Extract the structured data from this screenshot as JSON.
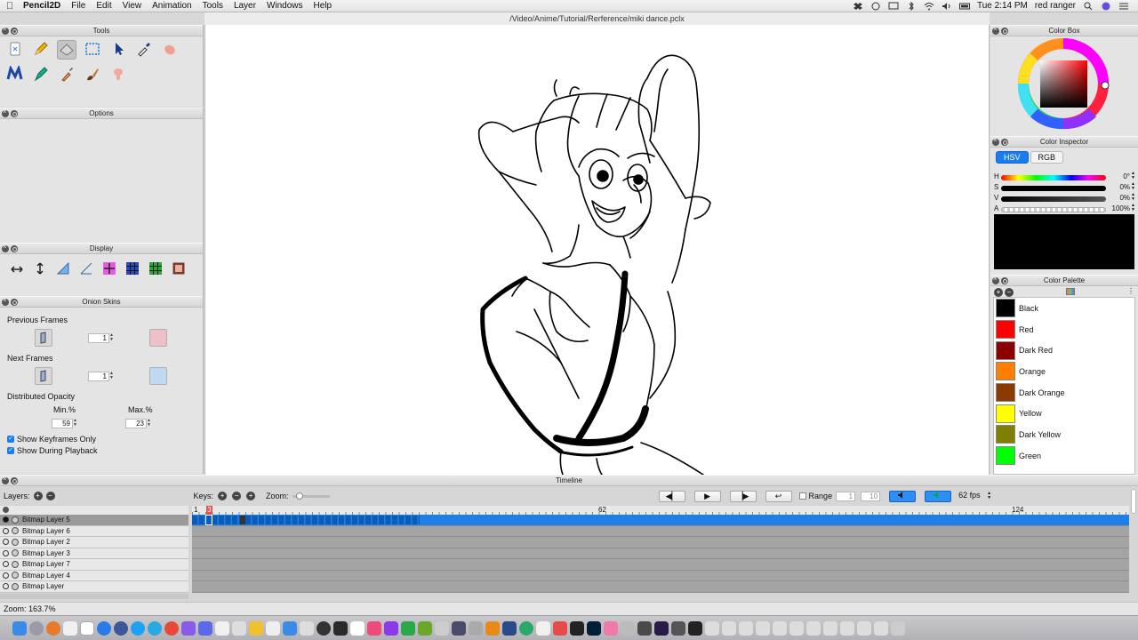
{
  "menubar": {
    "app_name": "Pencil2D",
    "items": [
      "File",
      "Edit",
      "View",
      "Animation",
      "Tools",
      "Layer",
      "Windows",
      "Help"
    ],
    "clock": "Tue 2:14 PM",
    "user": "red ranger"
  },
  "window": {
    "title": "/Video/Anime/Tutorial/Rerference/miki dance.pclx"
  },
  "panels": {
    "tools": "Tools",
    "options": "Options",
    "display": "Display",
    "onion": "Onion Skins",
    "color_box": "Color Box",
    "color_inspector": "Color Inspector",
    "color_palette": "Color Palette",
    "timeline": "Timeline"
  },
  "tools": [
    {
      "name": "clear-icon"
    },
    {
      "name": "pencil-icon"
    },
    {
      "name": "eraser-icon"
    },
    {
      "name": "select-icon"
    },
    {
      "name": "move-icon"
    },
    {
      "name": "eyedropper-icon"
    },
    {
      "name": "hand-icon"
    },
    {
      "name": "polyline-icon"
    },
    {
      "name": "pen-icon"
    },
    {
      "name": "bucket-icon"
    },
    {
      "name": "brush-icon"
    },
    {
      "name": "smudge-icon"
    }
  ],
  "onion": {
    "previous_frames": "Previous Frames",
    "prev_value": "1",
    "next_frames": "Next Frames",
    "next_value": "1",
    "distributed_opacity": "Distributed Opacity",
    "min_label": "Min.%",
    "max_label": "Max.%",
    "min_value": "59",
    "max_value": "23",
    "show_keyframes_only": "Show Keyframes Only",
    "show_during_playback": "Show During Playback"
  },
  "inspector": {
    "tab_hsv": "HSV",
    "tab_rgb": "RGB",
    "rows": [
      {
        "key": "H",
        "value": "0°"
      },
      {
        "key": "S",
        "value": "0%"
      },
      {
        "key": "V",
        "value": "0%"
      },
      {
        "key": "A",
        "value": "100%"
      }
    ]
  },
  "palette": [
    {
      "name": "Black",
      "color": "#000000"
    },
    {
      "name": "Red",
      "color": "#ff0000"
    },
    {
      "name": "Dark Red",
      "color": "#8b0000"
    },
    {
      "name": "Orange",
      "color": "#ff7f00"
    },
    {
      "name": "Dark Orange",
      "color": "#8b3a00"
    },
    {
      "name": "Yellow",
      "color": "#ffff00"
    },
    {
      "name": "Dark Yellow",
      "color": "#808000"
    },
    {
      "name": "Green",
      "color": "#00ff00"
    }
  ],
  "timeline": {
    "layers_label": "Layers:",
    "keys_label": "Keys:",
    "zoom_label": "Zoom:",
    "range_label": "Range",
    "range_start": "1",
    "range_end": "10",
    "fps": "62 fps",
    "ruler": [
      "1",
      "3",
      "62",
      "124"
    ],
    "layers": [
      {
        "name": "Bitmap Layer 5",
        "selected": true
      },
      {
        "name": "Bitmap Layer 6",
        "selected": false
      },
      {
        "name": "Bitmap Layer 2",
        "selected": false
      },
      {
        "name": "Bitmap Layer 3",
        "selected": false
      },
      {
        "name": "Bitmap Layer 7",
        "selected": false
      },
      {
        "name": "Bitmap Layer 4",
        "selected": false
      },
      {
        "name": "Bitmap Layer",
        "selected": false
      }
    ]
  },
  "status": {
    "zoom": "Zoom: 163.7%"
  },
  "colors": {
    "accent": "#1a7cf0",
    "timeline_blue": "#1e7fe6"
  }
}
